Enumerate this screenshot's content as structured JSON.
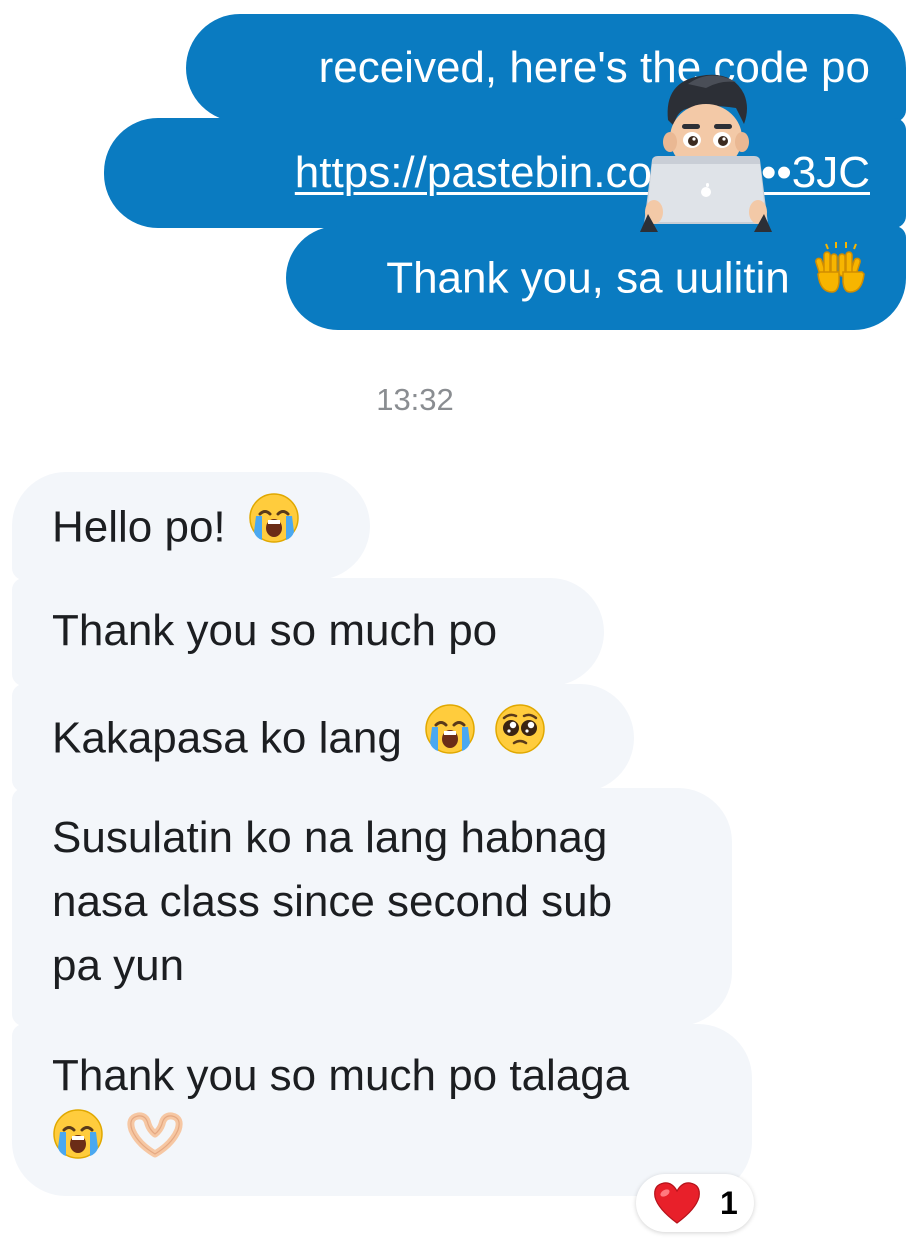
{
  "messages": {
    "outgoing": [
      {
        "text": "received, here's the code po"
      },
      {
        "link_text": "https://pastebin.com/E••••3JC"
      },
      {
        "text": "Thank you, sa uulitin"
      }
    ],
    "timestamp": "13:32",
    "incoming": [
      {
        "text": "Hello po!"
      },
      {
        "text": "Thank you so much po"
      },
      {
        "text": "Kakapasa ko lang"
      },
      {
        "lines": [
          "Susulatin ko na lang habnag",
          "nasa class since second sub",
          "pa yun"
        ]
      },
      {
        "text": "Thank you so much po talaga"
      }
    ]
  },
  "reaction": {
    "emoji": "red-heart",
    "count": "1"
  },
  "colors": {
    "outgoing_bubble": "#0a7bc1",
    "incoming_bubble": "#f3f6fa",
    "timestamp_text": "#8a8d91"
  },
  "icons": {
    "out3": "raising-hands-emoji",
    "in1": "loudly-crying-face-emoji",
    "in3": [
      "loudly-crying-face-emoji",
      "pleading-face-emoji"
    ],
    "in5": [
      "loudly-crying-face-emoji",
      "heart-hands-emoji"
    ],
    "avatar": "memoji-with-laptop"
  }
}
